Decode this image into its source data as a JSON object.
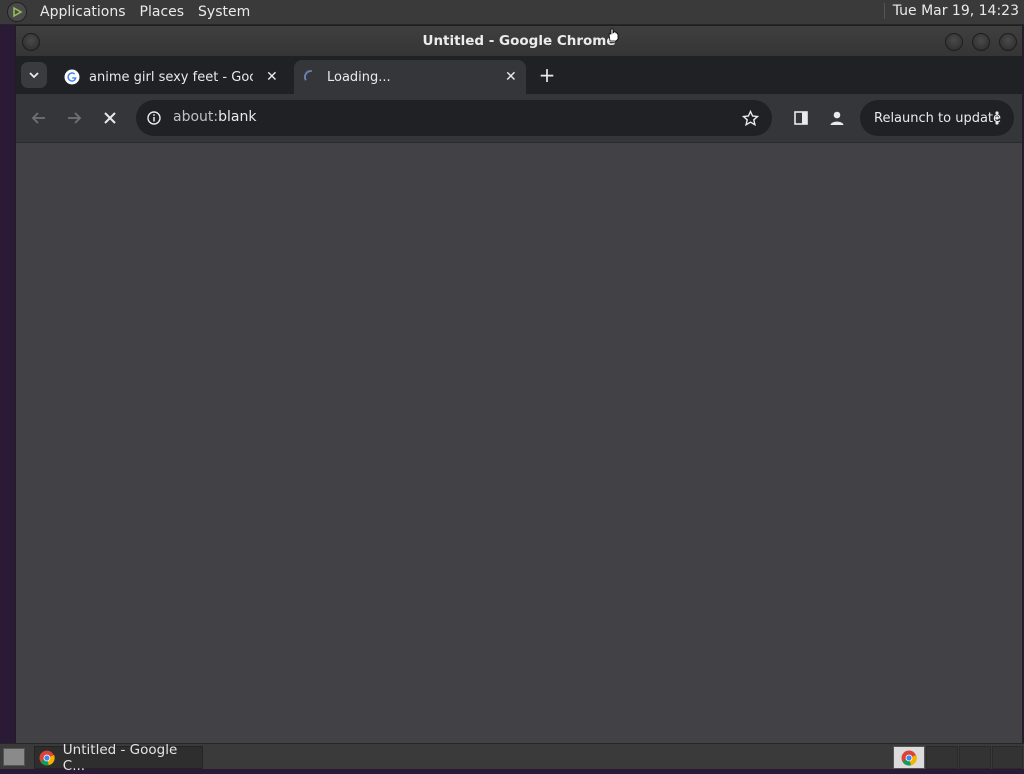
{
  "top_panel": {
    "menu": [
      "Applications",
      "Places",
      "System"
    ],
    "clock": "Tue Mar 19, 14:23"
  },
  "window": {
    "title": "Untitled - Google Chrome"
  },
  "tabs": [
    {
      "label": "anime girl sexy feet - Google",
      "icon": "google-g-icon"
    },
    {
      "label": "Loading...",
      "icon": "loading-spinner-icon",
      "active": true
    }
  ],
  "toolbar": {
    "url_scheme": "about:",
    "url_host": "blank",
    "relaunch_label": "Relaunch to update"
  },
  "taskbar": {
    "task_label": "Untitled - Google C..."
  },
  "colors": {
    "content_bg": "#424146",
    "tabstrip_bg": "#202124",
    "toolbar_bg": "#35363a"
  }
}
